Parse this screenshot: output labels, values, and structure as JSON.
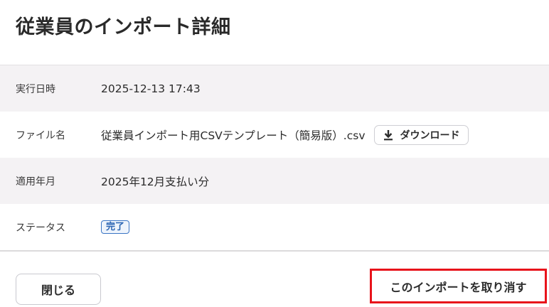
{
  "page": {
    "title": "従業員のインポート詳細"
  },
  "details": {
    "executed_at_label": "実行日時",
    "executed_at_value": "2025-12-13 17:43",
    "file_name_label": "ファイル名",
    "file_name_value": "従業員インポート用CSVテンプレート（簡易版）.csv",
    "download_label": "ダウンロード",
    "applied_month_label": "適用年月",
    "applied_month_value": "2025年12月支払い分",
    "status_label": "ステータス",
    "status_value": "完了"
  },
  "footer": {
    "close_label": "閉じる",
    "cancel_import_label": "このインポートを取り消す"
  },
  "icons": {
    "download": "download-icon"
  },
  "colors": {
    "row_shade": "#f4f2f4",
    "status_badge": "#2a64b3",
    "highlight_border": "#e8131b"
  }
}
